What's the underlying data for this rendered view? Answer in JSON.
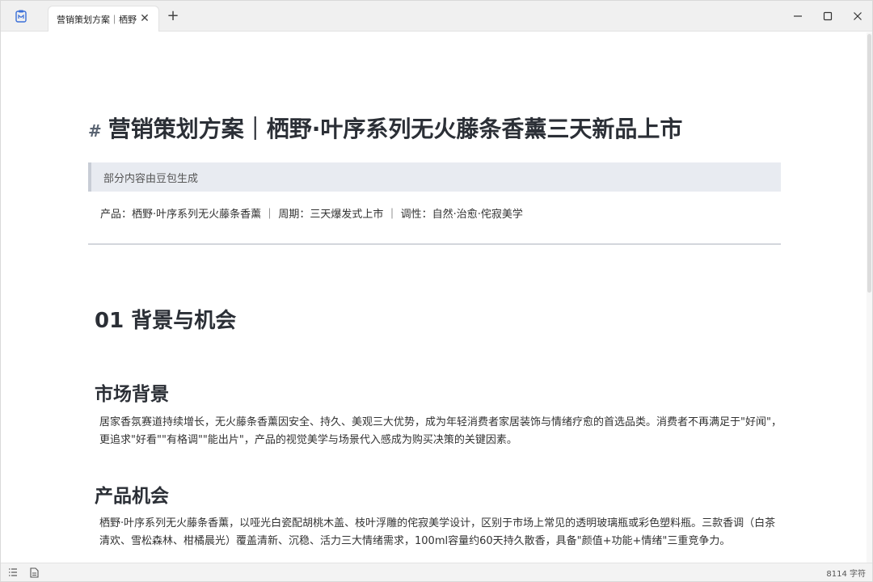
{
  "tab": {
    "title": "营销策划方案｜栖野",
    "close_label": "✕",
    "new_tab_label": "+"
  },
  "document": {
    "h1_hash": "#",
    "title": "营销策划方案｜栖野·叶序系列无火藤条香薰三天新品上市",
    "quote": "部分内容由豆包生成",
    "meta": "产品：栖野·叶序系列无火藤条香薰 ｜ 周期：三天爆发式上市 ｜ 调性：自然·治愈·侘寂美学",
    "section1_title": "01 背景与机会",
    "market_title": "市场背景",
    "market_para": "居家香氛赛道持续增长，无火藤条香薰因安全、持久、美观三大优势，成为年轻消费者家居装饰与情绪疗愈的首选品类。消费者不再满足于\"好闻\"，更追求\"好看\"\"有格调\"\"能出片\"，产品的视觉美学与场景代入感成为购买决策的关键因素。",
    "product_title": "产品机会",
    "product_para": "栖野·叶序系列无火藤条香薰，以哑光白瓷配胡桃木盖、枝叶浮雕的侘寂美学设计，区别于市场上常见的透明玻璃瓶或彩色塑料瓶。三款香调（白茶清欢、雪松森林、柑橘晨光）覆盖清新、沉稳、活力三大情绪需求，100ml容量约60天持久散香，具备\"颜值+功能+情绪\"三重竞争力。"
  },
  "status": {
    "word_count": "8114 字符"
  }
}
